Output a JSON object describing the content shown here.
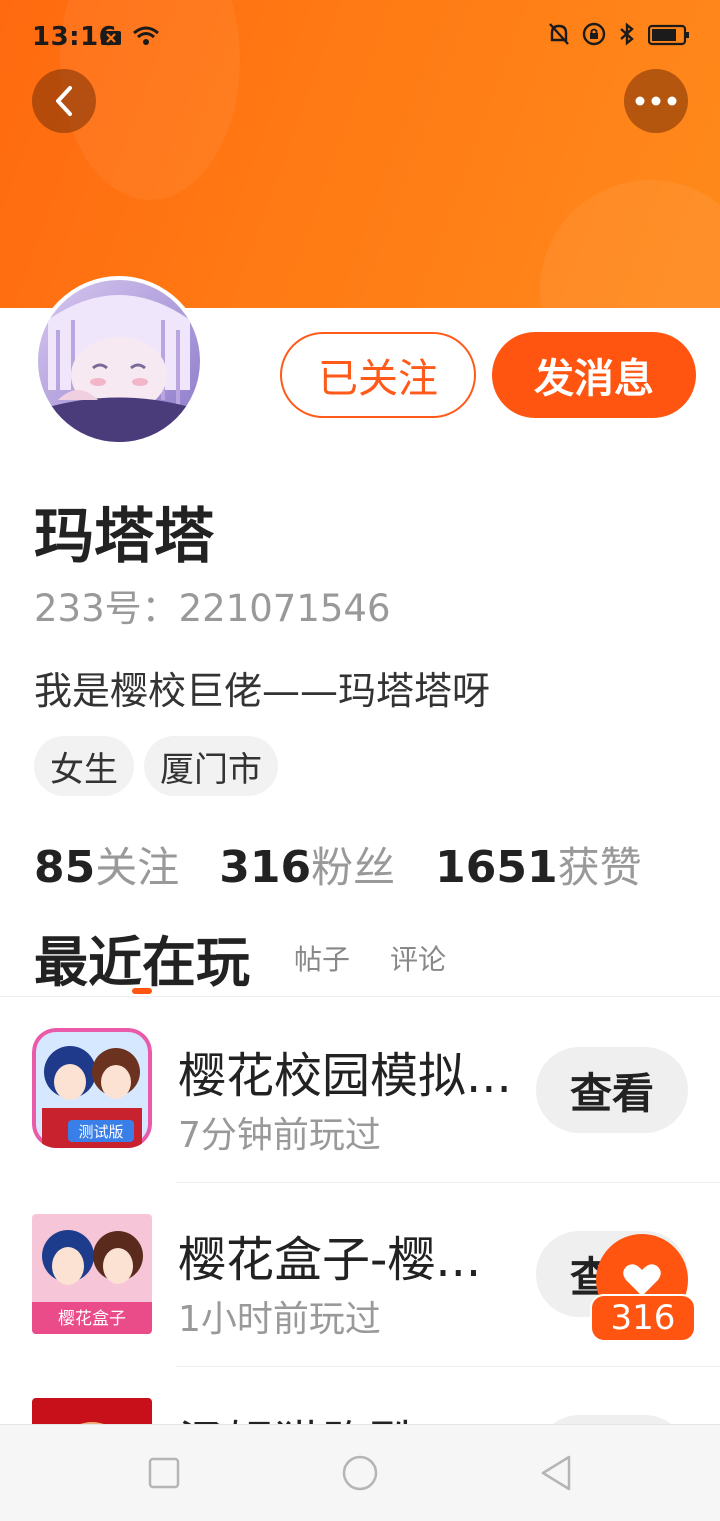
{
  "status_bar": {
    "time": "13:16",
    "icons": [
      "notification-x-icon",
      "wifi-icon",
      "mute-bell-icon",
      "rotation-lock-icon",
      "bluetooth-icon",
      "battery-icon"
    ]
  },
  "header": {
    "back_icon": "chevron-left-icon",
    "more_icon": "more-dots-icon"
  },
  "profile": {
    "name": "玛塔塔",
    "uid": "233号：221071546",
    "bio": "我是樱校巨佬——玛塔塔呀",
    "tags": [
      "女生",
      "厦门市"
    ],
    "follow_label": "已关注",
    "message_label": "发消息"
  },
  "stats": [
    {
      "count": "85",
      "label": "关注"
    },
    {
      "count": "316",
      "label": "粉丝"
    },
    {
      "count": "1651",
      "label": "获赞"
    }
  ],
  "tabs": {
    "active": "最近在玩",
    "posts": "帖子",
    "comments": "评论"
  },
  "games": [
    {
      "title": "樱花校园模拟...",
      "time": "7分钟前玩过",
      "button": "查看",
      "badge": "测试版"
    },
    {
      "title": "樱花盒子-樱...",
      "time": "1小时前玩过",
      "button": "查看",
      "badge": "樱花盒子"
    },
    {
      "title": "汤姆猫跑酷",
      "time": "",
      "button": "查看",
      "badge": ""
    }
  ],
  "like_float": {
    "count": "316",
    "icon": "heart-icon"
  },
  "colors": {
    "accent": "#ff5511",
    "header": "#ff7a14"
  }
}
